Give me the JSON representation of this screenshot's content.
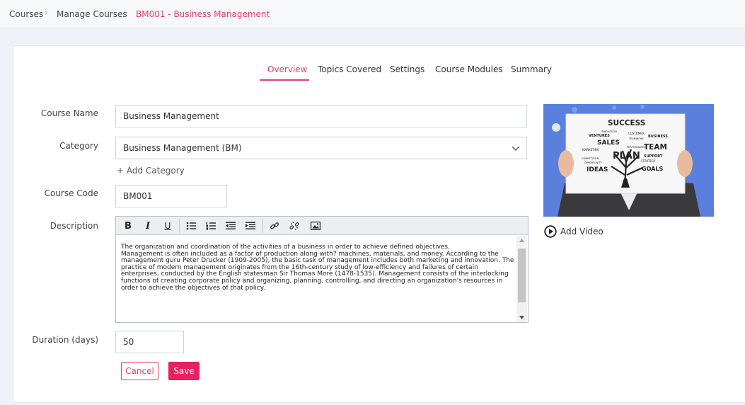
{
  "breadcrumb": {
    "items": [
      "Courses",
      "Manage Courses",
      "BM001 - Business Management"
    ]
  },
  "tabs": [
    {
      "label": "Overview",
      "active": true
    },
    {
      "label": "Topics Covered",
      "active": false
    },
    {
      "label": "Settings",
      "active": false
    },
    {
      "label": "Course Modules",
      "active": false
    },
    {
      "label": "Summary",
      "active": false
    }
  ],
  "form": {
    "course_name_label": "Course Name",
    "course_name_value": "Business Management",
    "category_label": "Category",
    "category_value": "Business Management (BM)",
    "add_category_label": "+ Add Category",
    "course_code_label": "Course Code",
    "course_code_value": "BM001",
    "description_label": "Description",
    "description_value": "The organization and coordination of the activities of a business in order to achieve defined objectives.\nManagement is often included as a factor of production along with? machines, materials, and money. According to the management guru Peter Drucker (1909-2005), the basic task of management includes both marketing and innovation. The practice of modern management originates from the 16th-century study of low-efficiency and failures of certain enterprises, conducted by the English statesman Sir Thomas More (1478-1535). Management consists of the interlocking functions of creating corporate policy and organizing, planning, controlling, and directing an organization's resources in order to achieve the objectives of that policy.",
    "duration_label": "Duration (days)",
    "duration_value": "50"
  },
  "toolbar": {
    "bold": "B",
    "italic": "I",
    "underline": "U"
  },
  "buttons": {
    "cancel": "Cancel",
    "save": "Save"
  },
  "media": {
    "image_words": {
      "success": "SUCCESS",
      "sales": "SALES",
      "team": "TEAM",
      "plan": "PLAN",
      "ideas": "IDEAS",
      "goals": "GOALS",
      "ventures": "VENTURES",
      "business": "BUSINESS",
      "marketing": "MARKETING",
      "support": "SUPPORT",
      "strategy": "STRATEGY",
      "innovation": "INNOVATION",
      "customer": "CUSTOMER",
      "teamwork": "TEAMWORK",
      "competition": "COMPETITION",
      "opportunity": "OPPORTUNITY",
      "performance": "PERFORMANCE"
    },
    "add_video_label": "Add Video"
  },
  "colors": {
    "accent": "#e83e6a",
    "save_bg": "#e5215f",
    "image_bg": "#5a7fdc"
  }
}
